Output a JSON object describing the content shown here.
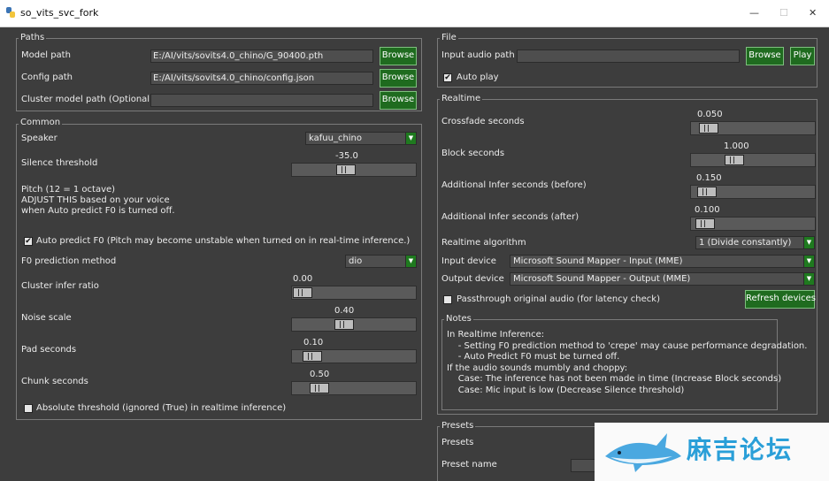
{
  "window": {
    "title": "so_vits_svc_fork",
    "minimize": "—",
    "maximize": "☐",
    "close": "✕"
  },
  "paths": {
    "legend": "Paths",
    "model_label": "Model path",
    "model_value": "E:/AI/vits/sovits4.0_chino/G_90400.pth",
    "config_label": "Config path",
    "config_value": "E:/AI/vits/sovits4.0_chino/config.json",
    "cluster_label": "Cluster model path (Optional)",
    "cluster_value": "",
    "browse": "Browse"
  },
  "common": {
    "legend": "Common",
    "speaker_label": "Speaker",
    "speaker_value": "kafuu_chino",
    "silence_label": "Silence threshold",
    "silence_value": "-35.0",
    "pitch_line1": "Pitch (12 = 1 octave)",
    "pitch_line2": "ADJUST THIS based on your voice",
    "pitch_line3": "when Auto predict F0 is turned off.",
    "auto_predict_label": "Auto predict F0 (Pitch may become unstable when turned on in real-time inference.)",
    "auto_predict_checked": true,
    "f0_label": "F0 prediction method",
    "f0_value": "dio",
    "cluster_ratio_label": "Cluster infer ratio",
    "cluster_ratio_value": "0.00",
    "noise_label": "Noise scale",
    "noise_value": "0.40",
    "pad_label": "Pad seconds",
    "pad_value": "0.10",
    "chunk_label": "Chunk seconds",
    "chunk_value": "0.50",
    "absolute_label": "Absolute threshold (ignored (True) in realtime inference)",
    "absolute_checked": false
  },
  "file": {
    "legend": "File",
    "input_label": "Input audio path",
    "input_value": "",
    "browse": "Browse",
    "play": "Play",
    "auto_play_label": "Auto play",
    "auto_play_checked": true
  },
  "realtime": {
    "legend": "Realtime",
    "crossfade_label": "Crossfade seconds",
    "crossfade_value": "0.050",
    "block_label": "Block seconds",
    "block_value": "1.000",
    "before_label": "Additional Infer seconds (before)",
    "before_value": "0.150",
    "after_label": "Additional Infer seconds (after)",
    "after_value": "0.100",
    "algorithm_label": "Realtime algorithm",
    "algorithm_value": "1 (Divide constantly)",
    "input_device_label": "Input device",
    "input_device_value": "Microsoft Sound Mapper - Input (MME)",
    "output_device_label": "Output device",
    "output_device_value": "Microsoft Sound Mapper - Output (MME)",
    "passthrough_label": "Passthrough original audio (for latency check)",
    "passthrough_checked": false,
    "refresh_label": "Refresh devices"
  },
  "notes": {
    "legend": "Notes",
    "body": "In Realtime Inference:\n    - Setting F0 prediction method to 'crepe' may cause performance degradation.\n    - Auto Predict F0 must be turned off.\nIf the audio sounds mumbly and choppy:\n    Case: The inference has not been made in time (Increase Block seconds)\n    Case: Mic input is low (Decrease Silence threshold)"
  },
  "presets": {
    "legend": "Presets",
    "presets_label": "Presets",
    "name_label": "Preset name"
  },
  "watermark": {
    "text": "麻吉论坛"
  },
  "colors": {
    "button": "#1f6b1f",
    "background": "#3d3d3d",
    "accent": "#2a9fd8"
  }
}
